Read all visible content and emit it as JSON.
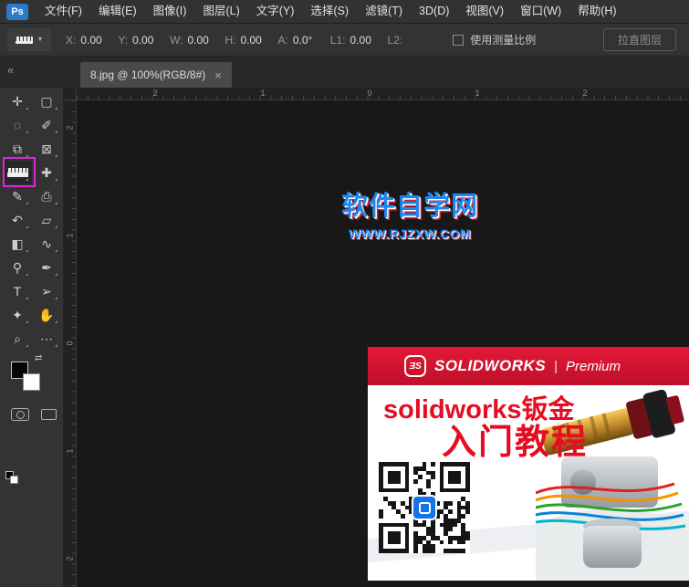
{
  "app": {
    "logo_text": "Ps"
  },
  "menu": {
    "items": [
      "文件(F)",
      "编辑(E)",
      "图像(I)",
      "图层(L)",
      "文字(Y)",
      "选择(S)",
      "滤镜(T)",
      "3D(D)",
      "视图(V)",
      "窗口(W)",
      "帮助(H)"
    ]
  },
  "options": {
    "tool_dropdown_caret": "▼",
    "fields": [
      {
        "label": "X:",
        "value": "0.00"
      },
      {
        "label": "Y:",
        "value": "0.00"
      },
      {
        "label": "W:",
        "value": "0.00"
      },
      {
        "label": "H:",
        "value": "0.00"
      },
      {
        "label": "A:",
        "value": "0.0°"
      },
      {
        "label": "L1:",
        "value": "0.00"
      },
      {
        "label": "L2:",
        "value": ""
      }
    ],
    "measure_scale_label": "使用测量比例",
    "straighten_button": "拉直图层"
  },
  "tab_bar": {
    "collapse_icon": "«",
    "active_tab": {
      "title": "8.jpg @ 100%(RGB/8#)",
      "close": "×"
    }
  },
  "tools": {
    "list": [
      {
        "name": "move",
        "glyph": "✛"
      },
      {
        "name": "marquee",
        "glyph": "▢"
      },
      {
        "name": "lasso",
        "glyph": "◌"
      },
      {
        "name": "quick-selection",
        "glyph": "✐"
      },
      {
        "name": "crop",
        "glyph": "⧉"
      },
      {
        "name": "frame",
        "glyph": "⊠"
      },
      {
        "name": "ruler",
        "glyph": ""
      },
      {
        "name": "healing",
        "glyph": "✚"
      },
      {
        "name": "brush",
        "glyph": "✎"
      },
      {
        "name": "clone-stamp",
        "glyph": "⎙"
      },
      {
        "name": "history-brush",
        "glyph": "↶"
      },
      {
        "name": "eraser",
        "glyph": "▱"
      },
      {
        "name": "gradient",
        "glyph": "◧"
      },
      {
        "name": "smudge",
        "glyph": "∿"
      },
      {
        "name": "dodge",
        "glyph": "⚲"
      },
      {
        "name": "pen",
        "glyph": "✒"
      },
      {
        "name": "type",
        "glyph": "T"
      },
      {
        "name": "path-selection",
        "glyph": "➢"
      },
      {
        "name": "shape",
        "glyph": "✦"
      },
      {
        "name": "hand",
        "glyph": "✋"
      },
      {
        "name": "zoom",
        "glyph": "⌕"
      },
      {
        "name": "more",
        "glyph": "⋯"
      }
    ],
    "swap_arrows_icon": "⇄"
  },
  "rulers": {
    "top_labels": [
      "2",
      "1",
      "0",
      "1",
      "2"
    ],
    "left_labels": [
      "2",
      "1",
      "0",
      "1",
      "2"
    ]
  },
  "document": {
    "watermark": {
      "title": "软件自学网",
      "subtitle": "WWW.RJZXW.COM"
    },
    "ad": {
      "logo_mark": "ƎS",
      "brand": "SOLIDWORKS",
      "divider": "|",
      "tier": "Premium",
      "headline_line1": "solidworks钣金",
      "headline_line2": "入门教程"
    }
  },
  "colors": {
    "highlight_magenta": "#d926d9",
    "ad_header_red": "#cf132e",
    "headline_red": "#e60c22",
    "watermark_blue": "#1d86f0",
    "watermark_shadow_red": "#d6252b",
    "qr_logo_blue": "#1673e6"
  }
}
